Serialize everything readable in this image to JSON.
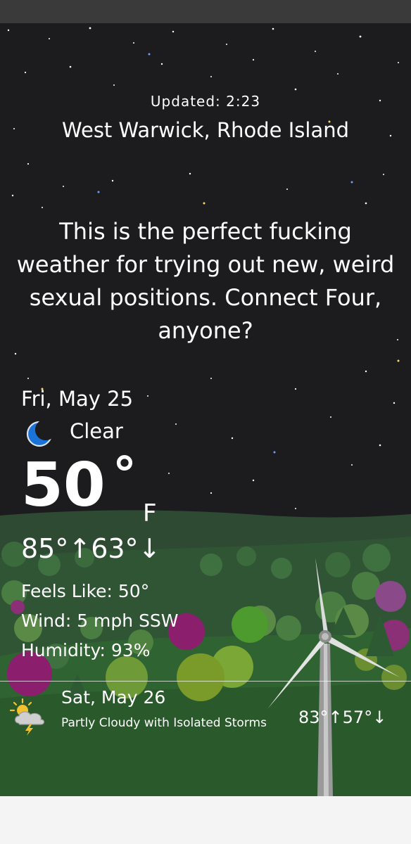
{
  "updated": "Updated: 2:23",
  "location": "West Warwick, Rhode Island",
  "quip": "This is the perfect fucking weather for trying out new, weird sexual positions. Connect Four, anyone?",
  "current": {
    "date": "Fri, May 25",
    "condition_icon": "moon-icon",
    "condition": "Clear",
    "temp": "50",
    "degree": "°",
    "unit": "F",
    "hilo": "85°↑63°↓",
    "feels_like": "Feels Like: 50°",
    "wind": "Wind: 5 mph SSW",
    "humidity": "Humidity: 93%"
  },
  "forecast": [
    {
      "date": "Sat, May 26",
      "icon": "partly-cloudy-storm-icon",
      "condition": "Partly Cloudy with Isolated Storms",
      "hilo": "83°↑57°↓"
    }
  ],
  "colors": {
    "sky": "#1c1c1e",
    "moon": "#1a73d9",
    "grass": "#2c5a2e",
    "text": "#ffffff",
    "status_bar": "#3a3a3a"
  }
}
